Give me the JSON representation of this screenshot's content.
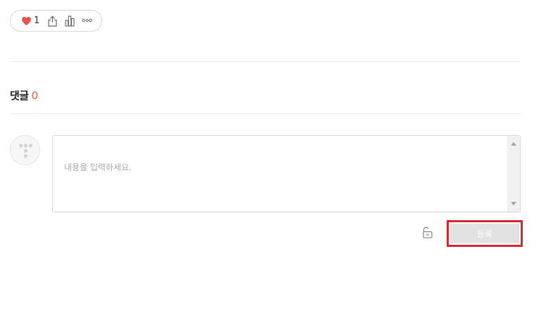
{
  "reactions": {
    "like_count": "1",
    "like_color": "#ef5350",
    "icons": [
      "heart-icon",
      "share-icon",
      "stats-icon",
      "more-icon"
    ]
  },
  "comments": {
    "heading": "댓글",
    "count": "0",
    "count_color": "#e85a4a"
  },
  "comment_form": {
    "placeholder": "내용을 입력하세요.",
    "value": "",
    "submit_label": "등록",
    "submit_highlight_color": "#d9262e",
    "avatar_icon": "default-avatar-icon",
    "lock_icon": "unlock-icon"
  }
}
